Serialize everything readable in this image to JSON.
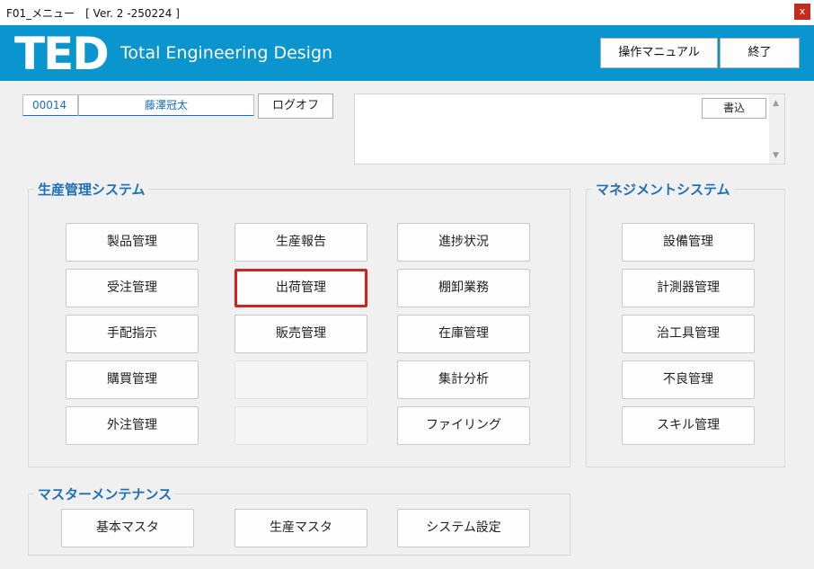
{
  "window": {
    "title": "F01_メニュー　[ Ver. 2 -250224 ]",
    "close_label": "x"
  },
  "header": {
    "logo": "TED",
    "tagline": "Total Engineering Design",
    "manual_button": "操作マニュアル",
    "exit_button": "終了",
    "colors": {
      "band": "#0b95cf"
    }
  },
  "user": {
    "id": "00014",
    "name": "藤澤冠太",
    "logoff_button": "ログオフ"
  },
  "memo": {
    "text": "",
    "write_button": "書込"
  },
  "production": {
    "title": "生産管理システム",
    "col1": [
      "製品管理",
      "受注管理",
      "手配指示",
      "購買管理",
      "外注管理"
    ],
    "col2": [
      "生産報告",
      "出荷管理",
      "販売管理",
      "",
      ""
    ],
    "col3": [
      "進捗状況",
      "棚卸業務",
      "在庫管理",
      "集計分析",
      "ファイリング"
    ],
    "selected": "出荷管理"
  },
  "management": {
    "title": "マネジメントシステム",
    "items": [
      "設備管理",
      "計測器管理",
      "治工具管理",
      "不良管理",
      "スキル管理"
    ]
  },
  "master": {
    "title": "マスターメンテナンス",
    "items": [
      "基本マスタ",
      "生産マスタ",
      "システム設定"
    ]
  }
}
